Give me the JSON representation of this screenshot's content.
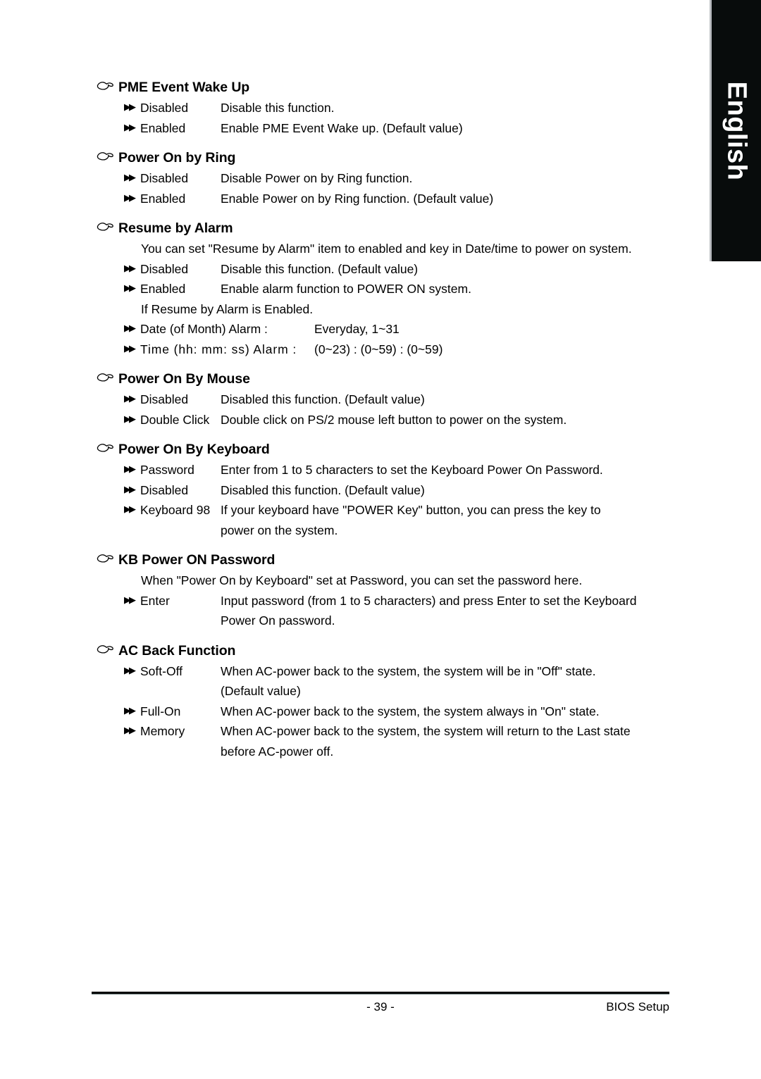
{
  "language_tab": {
    "label": "English"
  },
  "footer": {
    "page_number": "- 39 -",
    "section_label": "BIOS Setup"
  },
  "icons": {
    "heading_marker": "pointing-hand-icon",
    "option_marker": "double-triangle-right-icon"
  },
  "sections": [
    {
      "title": "PME Event Wake Up",
      "notes_before": [],
      "options": [
        {
          "label": "Disabled",
          "desc": "Disable this function."
        },
        {
          "label": "Enabled",
          "desc": "Enable PME Event Wake up. (Default value)"
        }
      ],
      "notes_mid": [],
      "options_after": []
    },
    {
      "title": "Power On by Ring",
      "notes_before": [],
      "options": [
        {
          "label": "Disabled",
          "desc": "Disable Power on by Ring function."
        },
        {
          "label": "Enabled",
          "desc": "Enable Power on by Ring function. (Default value)"
        }
      ],
      "notes_mid": [],
      "options_after": []
    },
    {
      "title": "Resume by Alarm",
      "notes_before": [
        "You can set \"Resume by Alarm\" item to enabled and key in Date/time to power on system."
      ],
      "options": [
        {
          "label": "Disabled",
          "desc": "Disable this function. (Default value)"
        },
        {
          "label": "Enabled",
          "desc": "Enable alarm function to POWER ON system."
        }
      ],
      "notes_mid": [
        "If Resume by Alarm is Enabled."
      ],
      "options_after": [
        {
          "label": "Date (of Month) Alarm :",
          "desc": "Everyday, 1~31",
          "style": "alarm"
        },
        {
          "label": "Time (hh: mm: ss) Alarm :",
          "desc": "(0~23) : (0~59) : (0~59)",
          "style": "alarm time"
        }
      ]
    },
    {
      "title": "Power On By Mouse",
      "notes_before": [],
      "options": [
        {
          "label": "Disabled",
          "desc": "Disabled this function. (Default value)"
        },
        {
          "label": "Double Click",
          "desc": "Double click on PS/2 mouse left button to power on the system."
        }
      ],
      "notes_mid": [],
      "options_after": []
    },
    {
      "title": "Power On By Keyboard",
      "notes_before": [],
      "options": [
        {
          "label": "Password",
          "desc": "Enter from 1 to 5 characters to set the Keyboard Power On Password."
        },
        {
          "label": "Disabled",
          "desc": "Disabled this function. (Default value)"
        },
        {
          "label": "Keyboard 98",
          "desc": "If your keyboard have \"POWER Key\" button, you can press the key to",
          "cont": "power on the system."
        }
      ],
      "notes_mid": [],
      "options_after": []
    },
    {
      "title": "KB Power ON Password",
      "notes_before": [
        "When \"Power On by Keyboard\" set at Password, you can set the password here."
      ],
      "options": [
        {
          "label": "Enter",
          "desc": "Input password (from 1 to 5 characters) and press Enter to set the Keyboard",
          "cont": "Power On password."
        }
      ],
      "notes_mid": [],
      "options_after": []
    },
    {
      "title": "AC Back Function",
      "notes_before": [],
      "options": [
        {
          "label": "Soft-Off",
          "desc": "When AC-power back to the system, the system will be in \"Off\" state.",
          "cont": "(Default value)"
        },
        {
          "label": "Full-On",
          "desc": "When AC-power back to the system, the system always in \"On\" state."
        },
        {
          "label": "Memory",
          "desc": "When AC-power back to the system, the system will return to the Last state",
          "cont": "before AC-power off."
        }
      ],
      "notes_mid": [],
      "options_after": []
    }
  ]
}
